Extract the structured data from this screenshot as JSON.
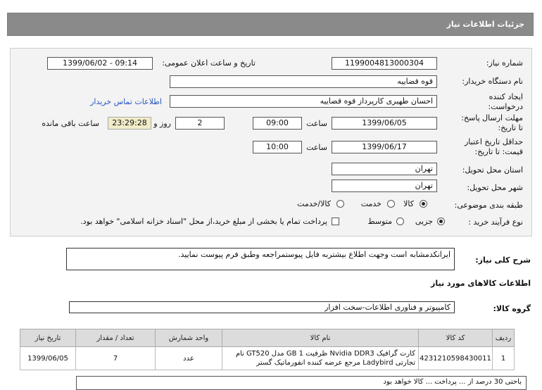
{
  "title": "جزئیات اطلاعات نیاز",
  "need_number": {
    "label": "شماره نیاز:",
    "value": "1199004813000304"
  },
  "announce": {
    "label": "تاریخ و ساعت اعلان عمومی:",
    "value": "1399/06/02 - 09:14"
  },
  "buyer": {
    "label": "نام دستگاه خریدار:",
    "value": "قوه قضاییه"
  },
  "creator": {
    "label_line1": "ایجاد کننده",
    "label_line2": "درخواست:",
    "value": "احسان طهیری کارپرداز قوه قضاییه",
    "contact_link": "اطلاعات تماس خریدار"
  },
  "deadline": {
    "label_line1": "مهلت ارسال پاسخ:",
    "label_line2": "تا تاریخ:",
    "date": "1399/06/05",
    "time_label": "ساعت",
    "time": "09:00",
    "days": "2",
    "days_label": "روز و",
    "remaining": "23:29:28",
    "remaining_label": "ساعت باقی مانده"
  },
  "validity": {
    "label_line1": "حداقل تاریخ اعتبار",
    "label_line2": "قیمت: تا تاریخ:",
    "date": "1399/06/17",
    "time_label": "ساعت",
    "time": "10:00"
  },
  "province": {
    "label": "استان محل تحویل:",
    "value": "تهران"
  },
  "city": {
    "label": "شهر محل تحویل:",
    "value": "تهران"
  },
  "category": {
    "label": "طبقه بندی موضوعی:",
    "options": [
      "کالا",
      "خدمت",
      "کالا/خدمت"
    ],
    "selected": "کالا"
  },
  "purchase": {
    "label": "نوع فرآیند خرید :",
    "options": [
      "جزیی",
      "متوسط"
    ],
    "selected": "جزیی",
    "payment_note": "پرداخت تمام یا بخشی از مبلغ خرید،از محل \"اسناد خزانه اسلامی\" خواهد بود."
  },
  "description": {
    "label": "شرح کلی نیاز:",
    "value": "ایرانکدمشابه است وجهت اطلاع بیشتربه فایل پیوستمراجعه وطبق فرم پیوست نمایید."
  },
  "goods_section": "اطلاعات کالاهای مورد نیاز",
  "goods_group": {
    "label": "گروه کالا:",
    "value": "کامپیوتر و فناوری اطلاعات-سخت افزار"
  },
  "table": {
    "headers": [
      "ردیف",
      "کد کالا",
      "نام کالا",
      "واحد شمارش",
      "تعداد / مقدار",
      "تاریخ نیاز"
    ],
    "rows": [
      {
        "row": "1",
        "code": "4231210598430011",
        "name": "کارت گرافیک Nvidia DDR3 ظرفیت GB 1 مدل GT520 نام تجارتی Ladybird مرجع عرضه کننده انفورماتیک گستر",
        "unit": "عدد",
        "qty": "7",
        "date": "1399/06/05"
      }
    ]
  },
  "bottom_note": "باحتی 30 درصد از ... پرداخت ... کالا خواهد بود"
}
